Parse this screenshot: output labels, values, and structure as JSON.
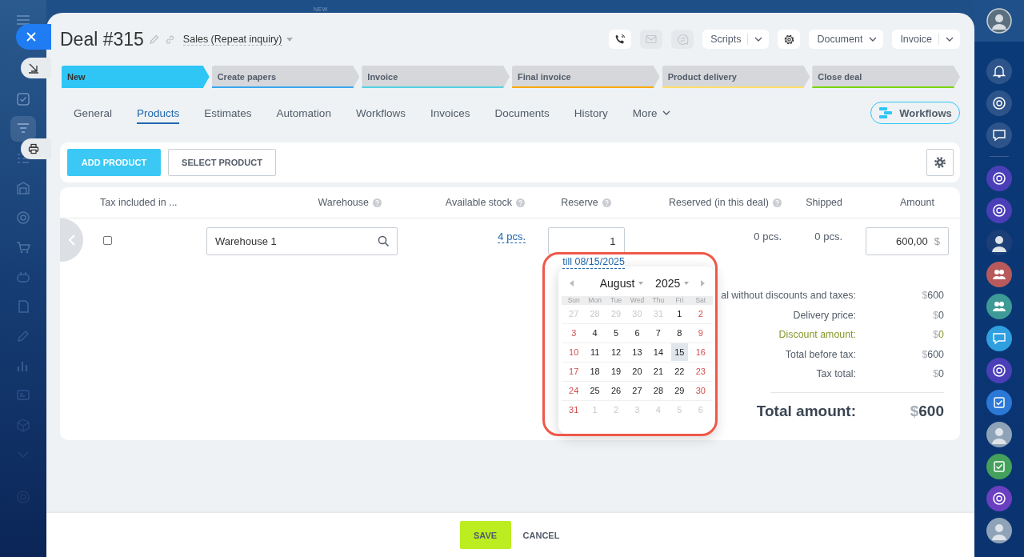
{
  "background_badge": "NEW",
  "deal": {
    "title": "Deal #315",
    "pipeline": "Sales (Repeat inquiry)"
  },
  "header_actions": [
    {
      "kind": "call",
      "disabled": false
    },
    {
      "kind": "mail",
      "disabled": true
    },
    {
      "kind": "chat",
      "disabled": true
    },
    {
      "kind": "split",
      "label": "Scripts"
    },
    {
      "kind": "settings"
    },
    {
      "kind": "dropdown",
      "label": "Document"
    },
    {
      "kind": "split",
      "label": "Invoice"
    }
  ],
  "stages": [
    {
      "label": "New",
      "selected": true,
      "color": "#2fc6f6"
    },
    {
      "label": "Create papers",
      "selected": false,
      "color": "#39a8ef"
    },
    {
      "label": "Invoice",
      "selected": false,
      "color": "#55d0e0"
    },
    {
      "label": "Final invoice",
      "selected": false,
      "color": "#ffa900"
    },
    {
      "label": "Product delivery",
      "selected": false,
      "color": "#ffe06a"
    },
    {
      "label": "Close deal",
      "selected": false,
      "color": "#7bd500"
    }
  ],
  "tabs": [
    {
      "label": "General",
      "selected": false,
      "kind": "tab"
    },
    {
      "label": "Products",
      "selected": true,
      "kind": "tab"
    },
    {
      "label": "Estimates",
      "selected": false,
      "kind": "tab"
    },
    {
      "label": "Automation",
      "selected": false,
      "kind": "tab"
    },
    {
      "label": "Workflows",
      "selected": false,
      "kind": "tab"
    },
    {
      "label": "Invoices",
      "selected": false,
      "kind": "tab"
    },
    {
      "label": "Documents",
      "selected": false,
      "kind": "tab"
    },
    {
      "label": "History",
      "selected": false,
      "kind": "tab"
    },
    {
      "label": "More",
      "selected": false,
      "kind": "menu"
    }
  ],
  "workflows_button": "Workflows",
  "products_toolbar": {
    "add": "ADD PRODUCT",
    "select": "SELECT PRODUCT"
  },
  "table": {
    "columns": [
      {
        "label": "Tax included in ...",
        "help": false
      },
      {
        "label": "Warehouse",
        "help": true
      },
      {
        "label": "Available stock",
        "help": true
      },
      {
        "label": "Reserve",
        "help": true
      },
      {
        "label": "Reserved (in this deal)",
        "help": true
      },
      {
        "label": "Shipped",
        "help": false
      },
      {
        "label": "Amount",
        "help": false
      }
    ],
    "rows": [
      {
        "tax_included": false,
        "warehouse": "Warehouse 1",
        "available_stock": "4 pcs.",
        "reserve": "1",
        "reserve_till": "till 08/15/2025",
        "reserved": "0 pcs.",
        "shipped": "0 pcs.",
        "amount": "600,00",
        "currency": "$"
      }
    ]
  },
  "date_picker": {
    "month": "August",
    "year": "2025",
    "weekdays": [
      "Sun",
      "Mon",
      "Tue",
      "Wed",
      "Thu",
      "Fri",
      "Sat"
    ],
    "weeks": [
      [
        {
          "day": "27",
          "kind": "outside",
          "selected": false
        },
        {
          "day": "28",
          "kind": "outside",
          "selected": false
        },
        {
          "day": "29",
          "kind": "outside",
          "selected": false
        },
        {
          "day": "30",
          "kind": "outside",
          "selected": false
        },
        {
          "day": "31",
          "kind": "outside",
          "selected": false
        },
        {
          "day": "1",
          "kind": "weekday",
          "selected": false
        },
        {
          "day": "2",
          "kind": "weekend",
          "selected": false
        }
      ],
      [
        {
          "day": "3",
          "kind": "weekend",
          "selected": false
        },
        {
          "day": "4",
          "kind": "weekday",
          "selected": false
        },
        {
          "day": "5",
          "kind": "weekday",
          "selected": false
        },
        {
          "day": "6",
          "kind": "weekday",
          "selected": false
        },
        {
          "day": "7",
          "kind": "weekday",
          "selected": false
        },
        {
          "day": "8",
          "kind": "weekday",
          "selected": false
        },
        {
          "day": "9",
          "kind": "weekend",
          "selected": false
        }
      ],
      [
        {
          "day": "10",
          "kind": "weekend",
          "selected": false
        },
        {
          "day": "11",
          "kind": "weekday",
          "selected": false
        },
        {
          "day": "12",
          "kind": "weekday",
          "selected": false
        },
        {
          "day": "13",
          "kind": "weekday",
          "selected": false
        },
        {
          "day": "14",
          "kind": "weekday",
          "selected": false
        },
        {
          "day": "15",
          "kind": "weekday",
          "selected": true
        },
        {
          "day": "16",
          "kind": "weekend",
          "selected": false
        }
      ],
      [
        {
          "day": "17",
          "kind": "weekend",
          "selected": false
        },
        {
          "day": "18",
          "kind": "weekday",
          "selected": false
        },
        {
          "day": "19",
          "kind": "weekday",
          "selected": false
        },
        {
          "day": "20",
          "kind": "weekday",
          "selected": false
        },
        {
          "day": "21",
          "kind": "weekday",
          "selected": false
        },
        {
          "day": "22",
          "kind": "weekday",
          "selected": false
        },
        {
          "day": "23",
          "kind": "weekend",
          "selected": false
        }
      ],
      [
        {
          "day": "24",
          "kind": "weekend",
          "selected": false
        },
        {
          "day": "25",
          "kind": "weekday",
          "selected": false
        },
        {
          "day": "26",
          "kind": "weekday",
          "selected": false
        },
        {
          "day": "27",
          "kind": "weekday",
          "selected": false
        },
        {
          "day": "28",
          "kind": "weekday",
          "selected": false
        },
        {
          "day": "29",
          "kind": "weekday",
          "selected": false
        },
        {
          "day": "30",
          "kind": "weekend",
          "selected": false
        }
      ],
      [
        {
          "day": "31",
          "kind": "weekend",
          "selected": false
        },
        {
          "day": "1",
          "kind": "outside",
          "selected": false
        },
        {
          "day": "2",
          "kind": "outside",
          "selected": false
        },
        {
          "day": "3",
          "kind": "outside",
          "selected": false
        },
        {
          "day": "4",
          "kind": "outside",
          "selected": false
        },
        {
          "day": "5",
          "kind": "outside",
          "selected": false
        },
        {
          "day": "6",
          "kind": "outside",
          "selected": false
        }
      ]
    ]
  },
  "totals": [
    {
      "label": "al without discounts and taxes:",
      "currency": "$",
      "value": "600",
      "kind": "normal"
    },
    {
      "label": "Delivery price:",
      "currency": "$",
      "value": "0",
      "kind": "normal"
    },
    {
      "label": "Discount amount:",
      "currency": "$",
      "value": "0",
      "kind": "discount"
    },
    {
      "label": "Total before tax:",
      "currency": "$",
      "value": "600",
      "kind": "normal"
    },
    {
      "label": "Tax total:",
      "currency": "$",
      "value": "0",
      "kind": "normal"
    },
    {
      "label": "Total amount:",
      "currency": "$",
      "value": "600",
      "kind": "grand"
    }
  ],
  "footer": {
    "save": "SAVE",
    "cancel": "CANCEL"
  }
}
